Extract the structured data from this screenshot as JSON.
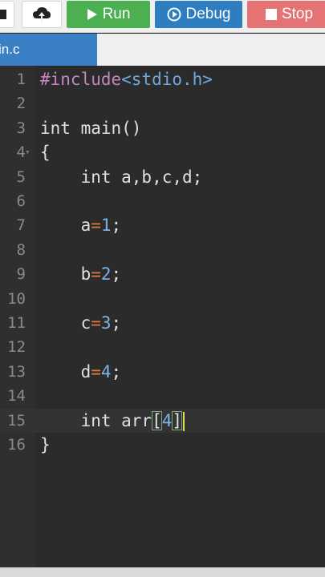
{
  "toolbar": {
    "run_label": "Run",
    "debug_label": "Debug",
    "stop_label": "Stop",
    "colors": {
      "run": "#4caf50",
      "debug": "#2e7dc0",
      "stop": "#e57373"
    }
  },
  "tabs": [
    {
      "label": "in.c"
    }
  ],
  "editor": {
    "active_line": "15",
    "lines": [
      {
        "n": "1",
        "segments": [
          {
            "text": "#include",
            "cls": "t-pre"
          },
          {
            "text": "<stdio.h>",
            "cls": "t-hdr"
          }
        ]
      },
      {
        "n": "2",
        "segments": []
      },
      {
        "n": "3",
        "segments": [
          {
            "text": "int main()",
            "cls": "t-text"
          }
        ]
      },
      {
        "n": "4",
        "segments": [
          {
            "text": "{",
            "cls": "t-text"
          }
        ]
      },
      {
        "n": "5",
        "segments": [
          {
            "text": "    int a,b,c,d;",
            "cls": "t-text"
          }
        ]
      },
      {
        "n": "6",
        "segments": []
      },
      {
        "n": "7",
        "segments": [
          {
            "text": "    a",
            "cls": "t-text"
          },
          {
            "text": "=",
            "cls": "t-op"
          },
          {
            "text": "1",
            "cls": "t-num"
          },
          {
            "text": ";",
            "cls": "t-text"
          }
        ]
      },
      {
        "n": "8",
        "segments": []
      },
      {
        "n": "9",
        "segments": [
          {
            "text": "    b",
            "cls": "t-text"
          },
          {
            "text": "=",
            "cls": "t-op"
          },
          {
            "text": "2",
            "cls": "t-num"
          },
          {
            "text": ";",
            "cls": "t-text"
          }
        ]
      },
      {
        "n": "10",
        "segments": []
      },
      {
        "n": "11",
        "segments": [
          {
            "text": "    c",
            "cls": "t-text"
          },
          {
            "text": "=",
            "cls": "t-op"
          },
          {
            "text": "3",
            "cls": "t-num"
          },
          {
            "text": ";",
            "cls": "t-text"
          }
        ]
      },
      {
        "n": "12",
        "segments": []
      },
      {
        "n": "13",
        "segments": [
          {
            "text": "    d",
            "cls": "t-text"
          },
          {
            "text": "=",
            "cls": "t-op"
          },
          {
            "text": "4",
            "cls": "t-num"
          },
          {
            "text": ";",
            "cls": "t-text"
          }
        ]
      },
      {
        "n": "14",
        "segments": []
      },
      {
        "n": "15",
        "segments": [
          {
            "text": "    int arr",
            "cls": "t-text"
          },
          {
            "text": "[",
            "cls": "t-text bracket"
          },
          {
            "text": "4",
            "cls": "t-num"
          },
          {
            "text": "]",
            "cls": "t-text bracket"
          }
        ],
        "cursor": true
      },
      {
        "n": "16",
        "segments": [
          {
            "text": "}",
            "cls": "t-text"
          }
        ]
      }
    ]
  }
}
